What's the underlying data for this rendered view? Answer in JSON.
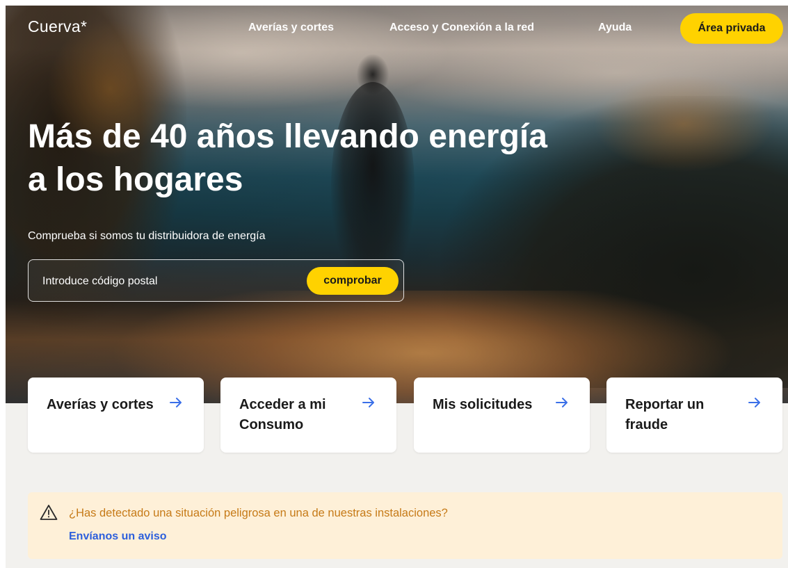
{
  "header": {
    "logo": "Cuerva*",
    "nav": [
      {
        "label": "Averías y cortes"
      },
      {
        "label": "Acceso y Conexión a la red"
      },
      {
        "label": "Ayuda"
      }
    ],
    "private_area_label": "Área privada"
  },
  "hero": {
    "title": "Más de 40 años llevando energía a los hogares",
    "subtitle": "Comprueba si somos tu distribuidora de energía",
    "search": {
      "placeholder": "Introduce código postal",
      "value": "",
      "button_label": "comprobar"
    }
  },
  "cards": [
    {
      "label": "Averías y cortes",
      "icon": "arrow-right-icon"
    },
    {
      "label": "Acceder a mi Consumo",
      "icon": "arrow-right-icon"
    },
    {
      "label": "Mis solicitudes",
      "icon": "arrow-right-icon"
    },
    {
      "label": "Reportar un fraude",
      "icon": "arrow-right-icon"
    }
  ],
  "alert": {
    "icon": "warning-icon",
    "text": "¿Has detectado una situación peligrosa en una de nuestras instalaciones?",
    "link_label": "Envíanos un aviso"
  },
  "colors": {
    "accent_yellow": "#ffd200",
    "link_blue": "#2d5fdc",
    "arrow_blue": "#3a6fe8",
    "alert_background": "#fef0d8",
    "alert_text": "#c67a17",
    "section_background": "#f2f1ee"
  }
}
